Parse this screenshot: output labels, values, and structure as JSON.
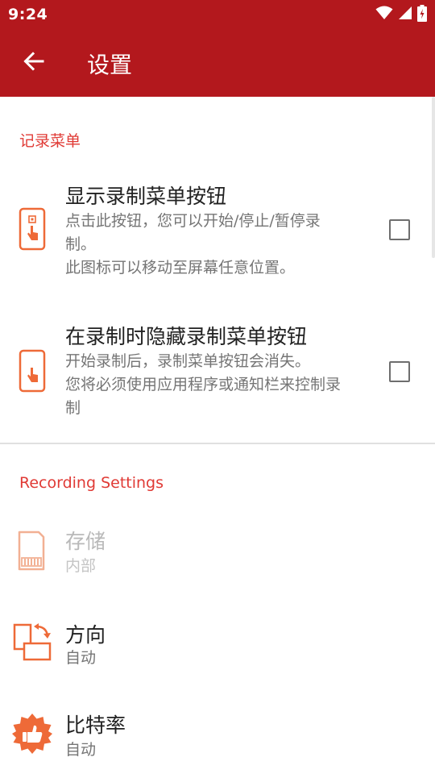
{
  "status_bar": {
    "time": "9:24",
    "icons": [
      "wifi-icon",
      "cell-signal-icon",
      "battery-charging-icon"
    ]
  },
  "app_bar": {
    "back_icon": "arrow-back-icon",
    "title": "设置"
  },
  "colors": {
    "primary": "#b3181d",
    "accent": "#e03a35",
    "icon": "#ee6a38",
    "title_text": "#212121",
    "summary_text": "#757575"
  },
  "sections": [
    {
      "header": "记录菜单",
      "items": [
        {
          "icon": "phone-touch-menu-icon",
          "title": "显示录制菜单按钮",
          "summary_lines": [
            "点击此按钮，您可以开始/停止/暂停录",
            "制。",
            "此图标可以移动至屏幕任意位置。"
          ],
          "checked": false
        },
        {
          "icon": "phone-touch-hide-icon",
          "title": "在录制时隐藏录制菜单按钮",
          "summary_lines": [
            "开始录制后，录制菜单按钮会消失。",
            "您将必须使用应用程序或通知栏来控制录",
            "制"
          ],
          "checked": false
        }
      ]
    },
    {
      "header": "Recording Settings",
      "items": [
        {
          "icon": "sd-card-icon",
          "title": "存储",
          "summary": "内部",
          "enabled": false
        },
        {
          "icon": "rotate-screen-icon",
          "title": "方向",
          "summary": "自动",
          "enabled": true
        },
        {
          "icon": "bitrate-badge-icon",
          "title": "比特率",
          "summary": "自动",
          "enabled": true
        }
      ]
    }
  ]
}
